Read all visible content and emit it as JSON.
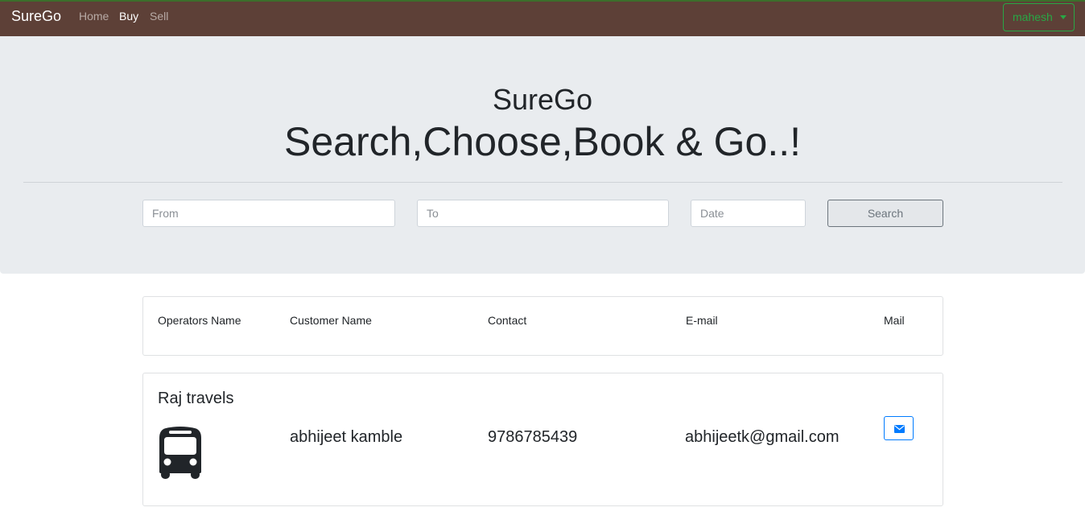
{
  "navbar": {
    "brand": "SureGo",
    "links": [
      {
        "label": "Home",
        "active": false
      },
      {
        "label": "Buy",
        "active": true
      },
      {
        "label": "Sell",
        "active": false
      }
    ],
    "user": "mahesh",
    "colors": {
      "background": "#5d4037",
      "user_accent": "#28a745"
    }
  },
  "hero": {
    "title": "SureGo",
    "tagline": "Search,Choose,Book & Go..!",
    "search": {
      "from_placeholder": "From",
      "to_placeholder": "To",
      "date_placeholder": "Date",
      "button_label": "Search"
    }
  },
  "table": {
    "headers": {
      "operator": "Operators Name",
      "customer": "Customer Name",
      "contact": "Contact",
      "email": "E-mail",
      "mail": "Mail"
    },
    "rows": [
      {
        "operator": "Raj travels",
        "operator_icon": "bus-icon",
        "customer": "abhijeet kamble",
        "contact": "9786785439",
        "email": "abhijeetk@gmail.com",
        "mail_icon": "envelope-icon"
      }
    ]
  }
}
